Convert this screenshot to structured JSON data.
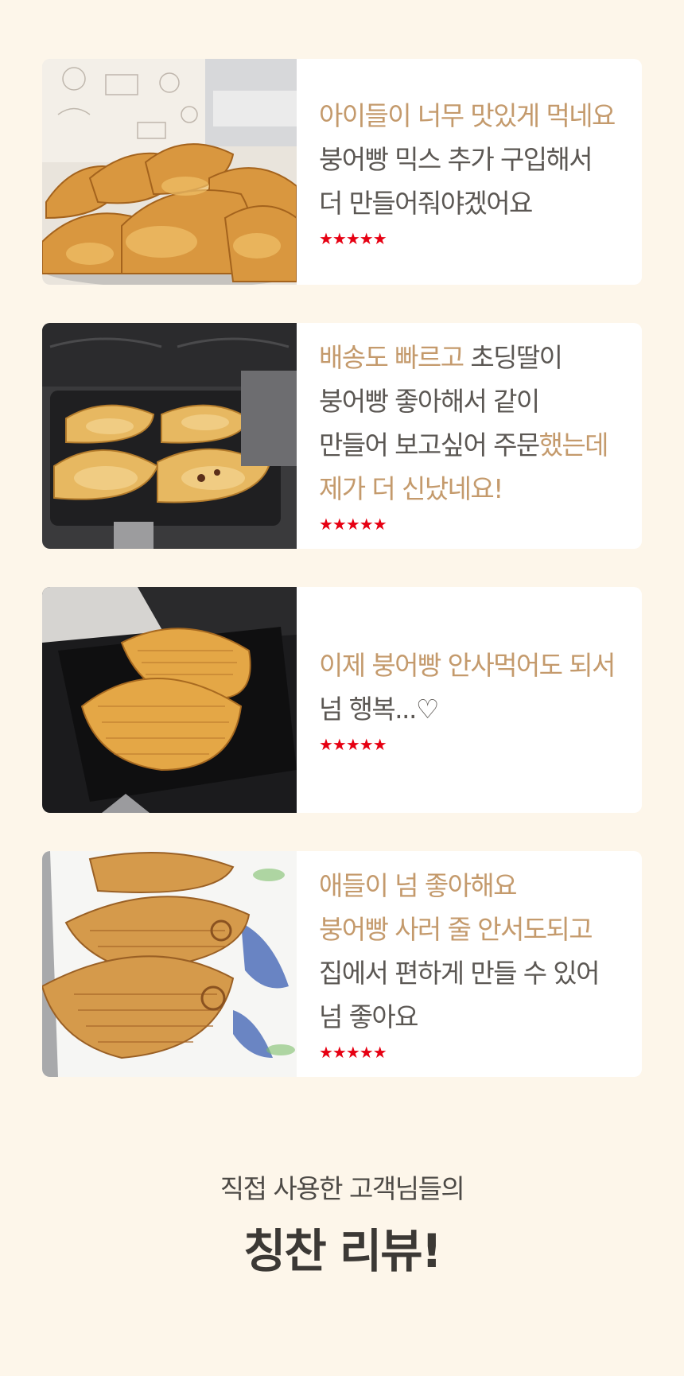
{
  "reviews": [
    {
      "photo_icon": "taiyaki-basket-photo",
      "lines": [
        [
          {
            "t": "아이들이 너무 맛있게 먹네요",
            "hl": true
          }
        ],
        [
          {
            "t": "붕어빵 믹스 추가 구입해서",
            "hl": false
          }
        ],
        [
          {
            "t": "더 만들어줘야겠어요",
            "hl": false
          }
        ]
      ],
      "rating": "★★★★★"
    },
    {
      "photo_icon": "taiyaki-pan-photo",
      "lines": [
        [
          {
            "t": "배송도 빠르고",
            "hl": true
          },
          {
            "t": " 초딩딸이",
            "hl": false
          }
        ],
        [
          {
            "t": "붕어빵 좋아해서 같이",
            "hl": false
          }
        ],
        [
          {
            "t": "만들어 보고싶어 주문",
            "hl": false
          },
          {
            "t": "했는데",
            "hl": true
          }
        ],
        [
          {
            "t": "제가 더 신났네요!",
            "hl": true
          }
        ]
      ],
      "rating": "★★★★★"
    },
    {
      "photo_icon": "taiyaki-mold-photo",
      "lines": [
        [
          {
            "t": "이제 붕어빵 안사먹어도 되서",
            "hl": true
          }
        ],
        [
          {
            "t": "넘 행복...♡",
            "hl": false
          }
        ]
      ],
      "rating": "★★★★★"
    },
    {
      "photo_icon": "taiyaki-plate-photo",
      "lines": [
        [
          {
            "t": "애들이 넘 좋아해요",
            "hl": true
          }
        ],
        [
          {
            "t": "붕어빵 사러 줄 안서도되고",
            "hl": true
          }
        ],
        [
          {
            "t": "집에서 편하게 만들 수 있어",
            "hl": false
          }
        ],
        [
          {
            "t": "넘 좋아요",
            "hl": false
          }
        ]
      ],
      "rating": "★★★★★"
    }
  ],
  "heading": {
    "sub": "직접 사용한 고객님들의",
    "main": "칭찬 리뷰!"
  },
  "colors": {
    "background": "#fdf6ea",
    "highlight": "#c49a6c",
    "text": "#5b5753",
    "star": "#e60012"
  }
}
